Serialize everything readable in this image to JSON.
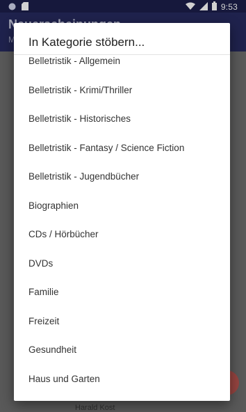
{
  "status_bar": {
    "time": "9:53",
    "icons": [
      "notification-dot-icon",
      "sd-card-icon",
      "wifi-icon",
      "signal-icon",
      "battery-icon"
    ]
  },
  "app": {
    "title": "Neuerscheinungen",
    "subtitle": "M",
    "behind_text": "Harald Kost"
  },
  "dialog": {
    "title": "In Kategorie stöbern...",
    "items": [
      "Belletristik - Allgemein",
      "Belletristik - Krimi/Thriller",
      "Belletristik - Historisches",
      "Belletristik - Fantasy / Science Fiction",
      "Belletristik - Jugendbücher",
      "Biographien",
      "CDs / Hörbücher",
      "DVDs",
      "Familie",
      "Freizeit",
      "Gesundheit",
      "Haus und Garten"
    ]
  },
  "colors": {
    "status_bar": "#1b1e4a",
    "app_bar": "#262a5e",
    "fab": "#b8534f",
    "dialog_bg": "#ffffff"
  }
}
